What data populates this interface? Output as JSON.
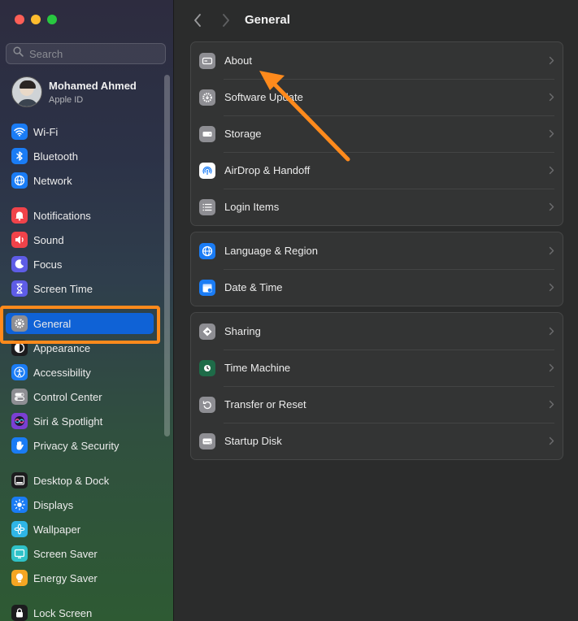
{
  "sidebar": {
    "search_placeholder": "Search",
    "account": {
      "name": "Mohamed Ahmed",
      "subtitle": "Apple ID"
    },
    "items": [
      {
        "label": "Wi-Fi",
        "icon": "wifi-icon",
        "color": "#1a7cf5"
      },
      {
        "label": "Bluetooth",
        "icon": "bluetooth-icon",
        "color": "#1a7cf5"
      },
      {
        "label": "Network",
        "icon": "globe-icon",
        "color": "#1a7cf5"
      },
      {
        "label": "Notifications",
        "icon": "bell-icon",
        "color": "#f0434a"
      },
      {
        "label": "Sound",
        "icon": "speaker-icon",
        "color": "#f0434a"
      },
      {
        "label": "Focus",
        "icon": "moon-icon",
        "color": "#5e5ce6"
      },
      {
        "label": "Screen Time",
        "icon": "hourglass-icon",
        "color": "#5e5ce6"
      },
      {
        "label": "General",
        "icon": "gear-icon",
        "color": "#8e8e93"
      },
      {
        "label": "Appearance",
        "icon": "appearance-icon",
        "color": "#1c1c1e"
      },
      {
        "label": "Accessibility",
        "icon": "accessibility-icon",
        "color": "#1a7cf5"
      },
      {
        "label": "Control Center",
        "icon": "toggles-icon",
        "color": "#8e8e93"
      },
      {
        "label": "Siri & Spotlight",
        "icon": "siri-icon",
        "color": "#7a3fd3"
      },
      {
        "label": "Privacy & Security",
        "icon": "hand-icon",
        "color": "#1a7cf5"
      },
      {
        "label": "Desktop & Dock",
        "icon": "dock-icon",
        "color": "#1c1c1e"
      },
      {
        "label": "Displays",
        "icon": "sun-icon",
        "color": "#1a7cf5"
      },
      {
        "label": "Wallpaper",
        "icon": "flower-icon",
        "color": "#2fb6e6"
      },
      {
        "label": "Screen Saver",
        "icon": "screensaver-icon",
        "color": "#2fc2c8"
      },
      {
        "label": "Energy Saver",
        "icon": "bulb-icon",
        "color": "#f5a623"
      },
      {
        "label": "Lock Screen",
        "icon": "lock-icon",
        "color": "#1c1c1e"
      }
    ]
  },
  "header": {
    "title": "General"
  },
  "groups": [
    [
      {
        "label": "About",
        "icon": "about-icon"
      },
      {
        "label": "Software Update",
        "icon": "software-update-icon"
      },
      {
        "label": "Storage",
        "icon": "storage-icon"
      },
      {
        "label": "AirDrop & Handoff",
        "icon": "airdrop-icon"
      },
      {
        "label": "Login Items",
        "icon": "list-icon"
      }
    ],
    [
      {
        "label": "Language & Region",
        "icon": "globe-icon"
      },
      {
        "label": "Date & Time",
        "icon": "calendar-icon"
      }
    ],
    [
      {
        "label": "Sharing",
        "icon": "sharing-icon"
      },
      {
        "label": "Time Machine",
        "icon": "time-machine-icon"
      },
      {
        "label": "Transfer or Reset",
        "icon": "reset-icon"
      },
      {
        "label": "Startup Disk",
        "icon": "disk-icon"
      }
    ]
  ],
  "colors": {
    "accent": "#0f62d6",
    "highlight": "#ff8a1c"
  }
}
